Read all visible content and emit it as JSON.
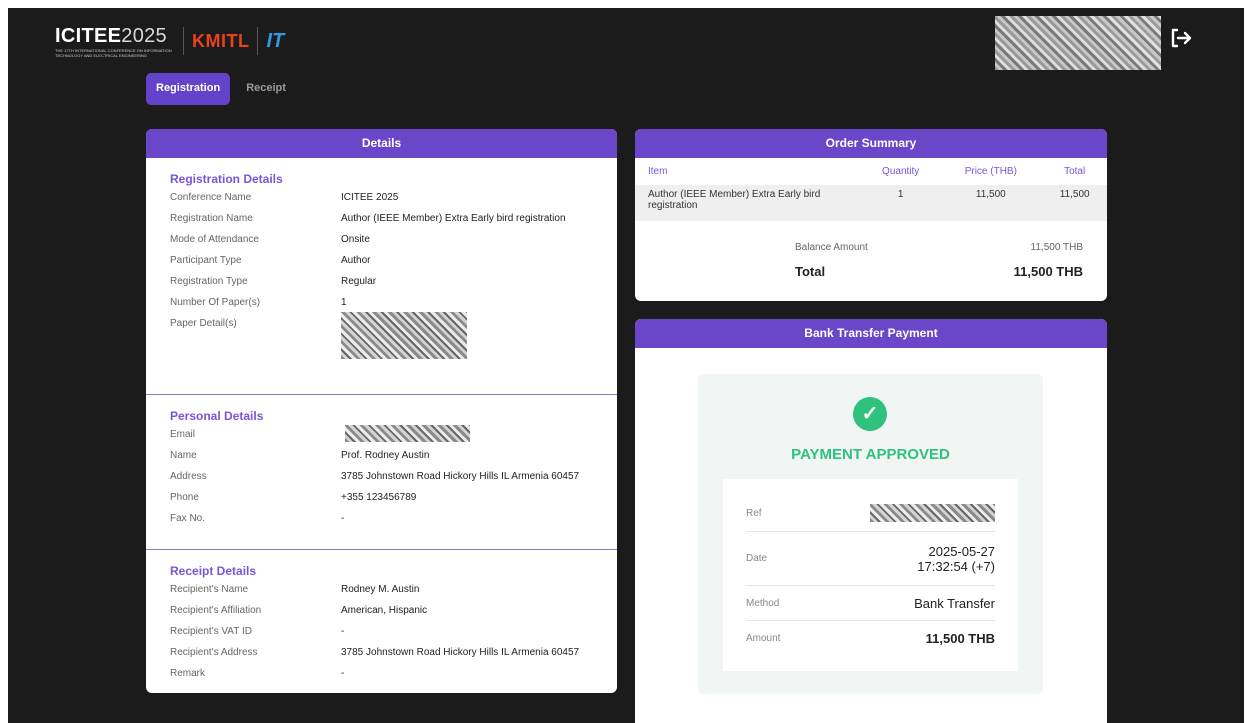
{
  "header": {
    "logo_icitee_main": "ICITEE",
    "logo_icitee_year": "2025",
    "logo_icitee_sub": "The 17th International Conference on Information Technology and Electrical Engineering",
    "logo_kmitl": "KMITL",
    "logo_it": "IT"
  },
  "tabs": [
    {
      "label": "Registration",
      "active": true
    },
    {
      "label": "Receipt",
      "active": false
    }
  ],
  "details": {
    "title": "Details",
    "registration": {
      "title": "Registration Details",
      "rows": [
        {
          "label": "Conference Name",
          "value": "ICITEE 2025"
        },
        {
          "label": "Registration Name",
          "value": "Author (IEEE Member) Extra Early bird registration"
        },
        {
          "label": "Mode of Attendance",
          "value": "Onsite"
        },
        {
          "label": "Participant Type",
          "value": "Author"
        },
        {
          "label": "Registration Type",
          "value": "Regular"
        },
        {
          "label": "Number Of Paper(s)",
          "value": "1"
        },
        {
          "label": "Paper Detail(s)",
          "value": ""
        }
      ]
    },
    "personal": {
      "title": "Personal Details",
      "rows": [
        {
          "label": "Email",
          "value": ""
        },
        {
          "label": "Name",
          "value": "Prof. Rodney Austin"
        },
        {
          "label": "Address",
          "value": "3785 Johnstown Road Hickory Hills IL Armenia 60457"
        },
        {
          "label": "Phone",
          "value": "+355 123456789"
        },
        {
          "label": "Fax No.",
          "value": "-"
        }
      ]
    },
    "receipt": {
      "title": "Receipt Details",
      "rows": [
        {
          "label": "Recipient's Name",
          "value": "Rodney M. Austin"
        },
        {
          "label": "Recipient's Affiliation",
          "value": "American, Hispanic"
        },
        {
          "label": "Recipient's VAT ID",
          "value": "-"
        },
        {
          "label": "Recipient's Address",
          "value": "3785 Johnstown Road Hickory Hills IL Armenia 60457"
        },
        {
          "label": "Remark",
          "value": "-"
        }
      ]
    }
  },
  "order": {
    "title": "Order Summary",
    "columns": [
      "Item",
      "Quantity",
      "Price (THB)",
      "Total"
    ],
    "rows": [
      {
        "item": "Author (IEEE Member) Extra Early bird registration",
        "quantity": "1",
        "price": "11,500",
        "total": "11,500"
      }
    ],
    "balance_label": "Balance Amount",
    "balance_value": "11,500 THB",
    "total_label": "Total",
    "total_value": "11,500 THB"
  },
  "bank": {
    "title": "Bank Transfer Payment",
    "status": "PAYMENT APPROVED",
    "ref_label": "Ref",
    "date_label": "Date",
    "date_value": "2025-05-27",
    "time_value": "17:32:54 (+7)",
    "method_label": "Method",
    "method_value": "Bank Transfer",
    "amount_label": "Amount",
    "amount_value": "11,500 THB"
  },
  "colors": {
    "accent": "#6a46c8",
    "approved": "#2ec27e",
    "background": "#1b1b1b"
  }
}
